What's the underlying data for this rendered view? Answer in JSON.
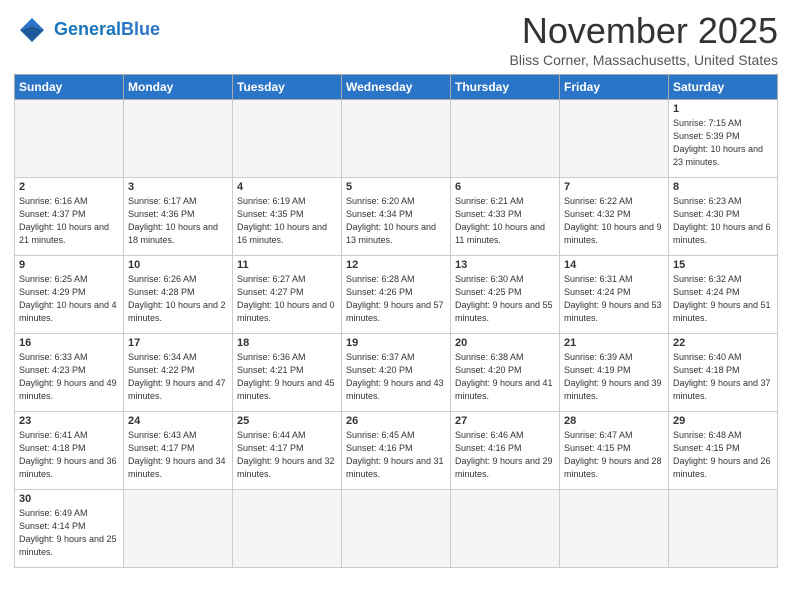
{
  "header": {
    "logo_general": "General",
    "logo_blue": "Blue",
    "month_title": "November 2025",
    "location": "Bliss Corner, Massachusetts, United States"
  },
  "weekdays": [
    "Sunday",
    "Monday",
    "Tuesday",
    "Wednesday",
    "Thursday",
    "Friday",
    "Saturday"
  ],
  "weeks": [
    [
      {
        "day": "",
        "info": ""
      },
      {
        "day": "",
        "info": ""
      },
      {
        "day": "",
        "info": ""
      },
      {
        "day": "",
        "info": ""
      },
      {
        "day": "",
        "info": ""
      },
      {
        "day": "",
        "info": ""
      },
      {
        "day": "1",
        "info": "Sunrise: 7:15 AM\nSunset: 5:39 PM\nDaylight: 10 hours\nand 23 minutes."
      }
    ],
    [
      {
        "day": "2",
        "info": "Sunrise: 6:16 AM\nSunset: 4:37 PM\nDaylight: 10 hours\nand 21 minutes."
      },
      {
        "day": "3",
        "info": "Sunrise: 6:17 AM\nSunset: 4:36 PM\nDaylight: 10 hours\nand 18 minutes."
      },
      {
        "day": "4",
        "info": "Sunrise: 6:19 AM\nSunset: 4:35 PM\nDaylight: 10 hours\nand 16 minutes."
      },
      {
        "day": "5",
        "info": "Sunrise: 6:20 AM\nSunset: 4:34 PM\nDaylight: 10 hours\nand 13 minutes."
      },
      {
        "day": "6",
        "info": "Sunrise: 6:21 AM\nSunset: 4:33 PM\nDaylight: 10 hours\nand 11 minutes."
      },
      {
        "day": "7",
        "info": "Sunrise: 6:22 AM\nSunset: 4:32 PM\nDaylight: 10 hours\nand 9 minutes."
      },
      {
        "day": "8",
        "info": "Sunrise: 6:23 AM\nSunset: 4:30 PM\nDaylight: 10 hours\nand 6 minutes."
      }
    ],
    [
      {
        "day": "9",
        "info": "Sunrise: 6:25 AM\nSunset: 4:29 PM\nDaylight: 10 hours\nand 4 minutes."
      },
      {
        "day": "10",
        "info": "Sunrise: 6:26 AM\nSunset: 4:28 PM\nDaylight: 10 hours\nand 2 minutes."
      },
      {
        "day": "11",
        "info": "Sunrise: 6:27 AM\nSunset: 4:27 PM\nDaylight: 10 hours\nand 0 minutes."
      },
      {
        "day": "12",
        "info": "Sunrise: 6:28 AM\nSunset: 4:26 PM\nDaylight: 9 hours\nand 57 minutes."
      },
      {
        "day": "13",
        "info": "Sunrise: 6:30 AM\nSunset: 4:25 PM\nDaylight: 9 hours\nand 55 minutes."
      },
      {
        "day": "14",
        "info": "Sunrise: 6:31 AM\nSunset: 4:24 PM\nDaylight: 9 hours\nand 53 minutes."
      },
      {
        "day": "15",
        "info": "Sunrise: 6:32 AM\nSunset: 4:24 PM\nDaylight: 9 hours\nand 51 minutes."
      }
    ],
    [
      {
        "day": "16",
        "info": "Sunrise: 6:33 AM\nSunset: 4:23 PM\nDaylight: 9 hours\nand 49 minutes."
      },
      {
        "day": "17",
        "info": "Sunrise: 6:34 AM\nSunset: 4:22 PM\nDaylight: 9 hours\nand 47 minutes."
      },
      {
        "day": "18",
        "info": "Sunrise: 6:36 AM\nSunset: 4:21 PM\nDaylight: 9 hours\nand 45 minutes."
      },
      {
        "day": "19",
        "info": "Sunrise: 6:37 AM\nSunset: 4:20 PM\nDaylight: 9 hours\nand 43 minutes."
      },
      {
        "day": "20",
        "info": "Sunrise: 6:38 AM\nSunset: 4:20 PM\nDaylight: 9 hours\nand 41 minutes."
      },
      {
        "day": "21",
        "info": "Sunrise: 6:39 AM\nSunset: 4:19 PM\nDaylight: 9 hours\nand 39 minutes."
      },
      {
        "day": "22",
        "info": "Sunrise: 6:40 AM\nSunset: 4:18 PM\nDaylight: 9 hours\nand 37 minutes."
      }
    ],
    [
      {
        "day": "23",
        "info": "Sunrise: 6:41 AM\nSunset: 4:18 PM\nDaylight: 9 hours\nand 36 minutes."
      },
      {
        "day": "24",
        "info": "Sunrise: 6:43 AM\nSunset: 4:17 PM\nDaylight: 9 hours\nand 34 minutes."
      },
      {
        "day": "25",
        "info": "Sunrise: 6:44 AM\nSunset: 4:17 PM\nDaylight: 9 hours\nand 32 minutes."
      },
      {
        "day": "26",
        "info": "Sunrise: 6:45 AM\nSunset: 4:16 PM\nDaylight: 9 hours\nand 31 minutes."
      },
      {
        "day": "27",
        "info": "Sunrise: 6:46 AM\nSunset: 4:16 PM\nDaylight: 9 hours\nand 29 minutes."
      },
      {
        "day": "28",
        "info": "Sunrise: 6:47 AM\nSunset: 4:15 PM\nDaylight: 9 hours\nand 28 minutes."
      },
      {
        "day": "29",
        "info": "Sunrise: 6:48 AM\nSunset: 4:15 PM\nDaylight: 9 hours\nand 26 minutes."
      }
    ],
    [
      {
        "day": "30",
        "info": "Sunrise: 6:49 AM\nSunset: 4:14 PM\nDaylight: 9 hours\nand 25 minutes."
      },
      {
        "day": "",
        "info": ""
      },
      {
        "day": "",
        "info": ""
      },
      {
        "day": "",
        "info": ""
      },
      {
        "day": "",
        "info": ""
      },
      {
        "day": "",
        "info": ""
      },
      {
        "day": "",
        "info": ""
      }
    ]
  ]
}
